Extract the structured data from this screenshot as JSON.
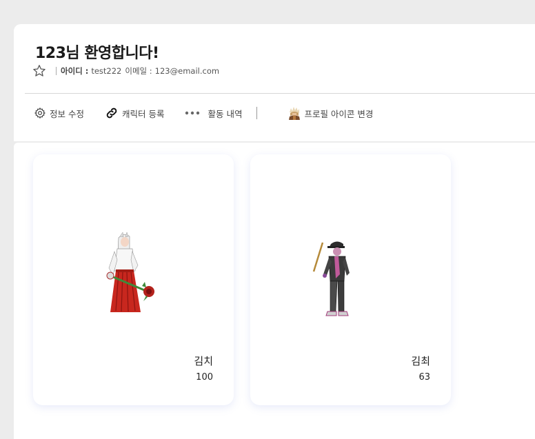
{
  "header": {
    "welcome_title": "123님 환영합니다!",
    "id_label": "아이디 :",
    "id_value": "test222",
    "email_label": "이메일 :",
    "email_value": "123@email.com"
  },
  "actions": {
    "edit_info": "정보 수정",
    "register_character": "캐릭터 등록",
    "activity_history": "활동 내역",
    "change_profile_icon": "프로필 아이콘 변경"
  },
  "characters": [
    {
      "name": "김치",
      "level": "100",
      "sprite": "shrine-maiden-character-sprite"
    },
    {
      "name": "김최",
      "level": "63",
      "sprite": "capped-staff-character-sprite"
    }
  ],
  "colors": {
    "background": "#ececec",
    "card": "#ffffff",
    "text": "#222222",
    "muted": "#555555",
    "card_shadow": "#788cdc"
  }
}
